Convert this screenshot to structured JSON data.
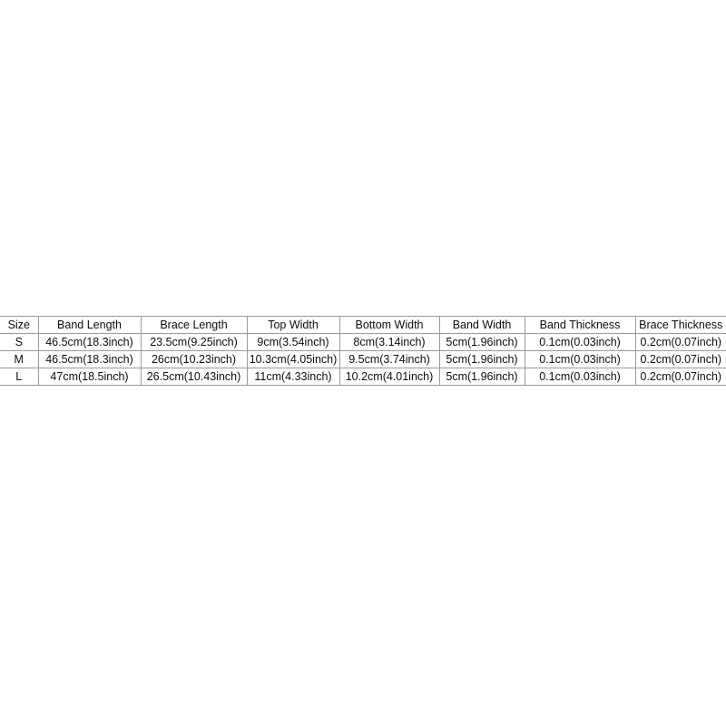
{
  "page": {
    "background_color": "#ffffff",
    "text_color": "#0d0d0d",
    "border_color": "#9a9a9a"
  },
  "size_table": {
    "columns": [
      {
        "key": "size",
        "label": "Size"
      },
      {
        "key": "band_length",
        "label": "Band Length"
      },
      {
        "key": "brace_length",
        "label": "Brace Length"
      },
      {
        "key": "top_width",
        "label": "Top Width"
      },
      {
        "key": "bottom_width",
        "label": "Bottom Width"
      },
      {
        "key": "band_width",
        "label": "Band Width"
      },
      {
        "key": "band_thickness",
        "label": "Band Thickness"
      },
      {
        "key": "brace_thickness",
        "label": "Brace Thickness"
      }
    ],
    "rows": [
      {
        "size": "S",
        "band_length": "46.5cm(18.3inch)",
        "brace_length": "23.5cm(9.25inch)",
        "top_width": "9cm(3.54inch)",
        "bottom_width": "8cm(3.14inch)",
        "band_width": "5cm(1.96inch)",
        "band_thickness": "0.1cm(0.03inch)",
        "brace_thickness": "0.2cm(0.07inch)"
      },
      {
        "size": "M",
        "band_length": "46.5cm(18.3inch)",
        "brace_length": "26cm(10.23inch)",
        "top_width": "10.3cm(4.05inch)",
        "bottom_width": "9.5cm(3.74inch)",
        "band_width": "5cm(1.96inch)",
        "band_thickness": "0.1cm(0.03inch)",
        "brace_thickness": "0.2cm(0.07inch)"
      },
      {
        "size": "L",
        "band_length": "47cm(18.5inch)",
        "brace_length": "26.5cm(10.43inch)",
        "top_width": "11cm(4.33inch)",
        "bottom_width": "10.2cm(4.01inch)",
        "band_width": "5cm(1.96inch)",
        "band_thickness": "0.1cm(0.03inch)",
        "brace_thickness": "0.2cm(0.07inch)"
      }
    ]
  }
}
